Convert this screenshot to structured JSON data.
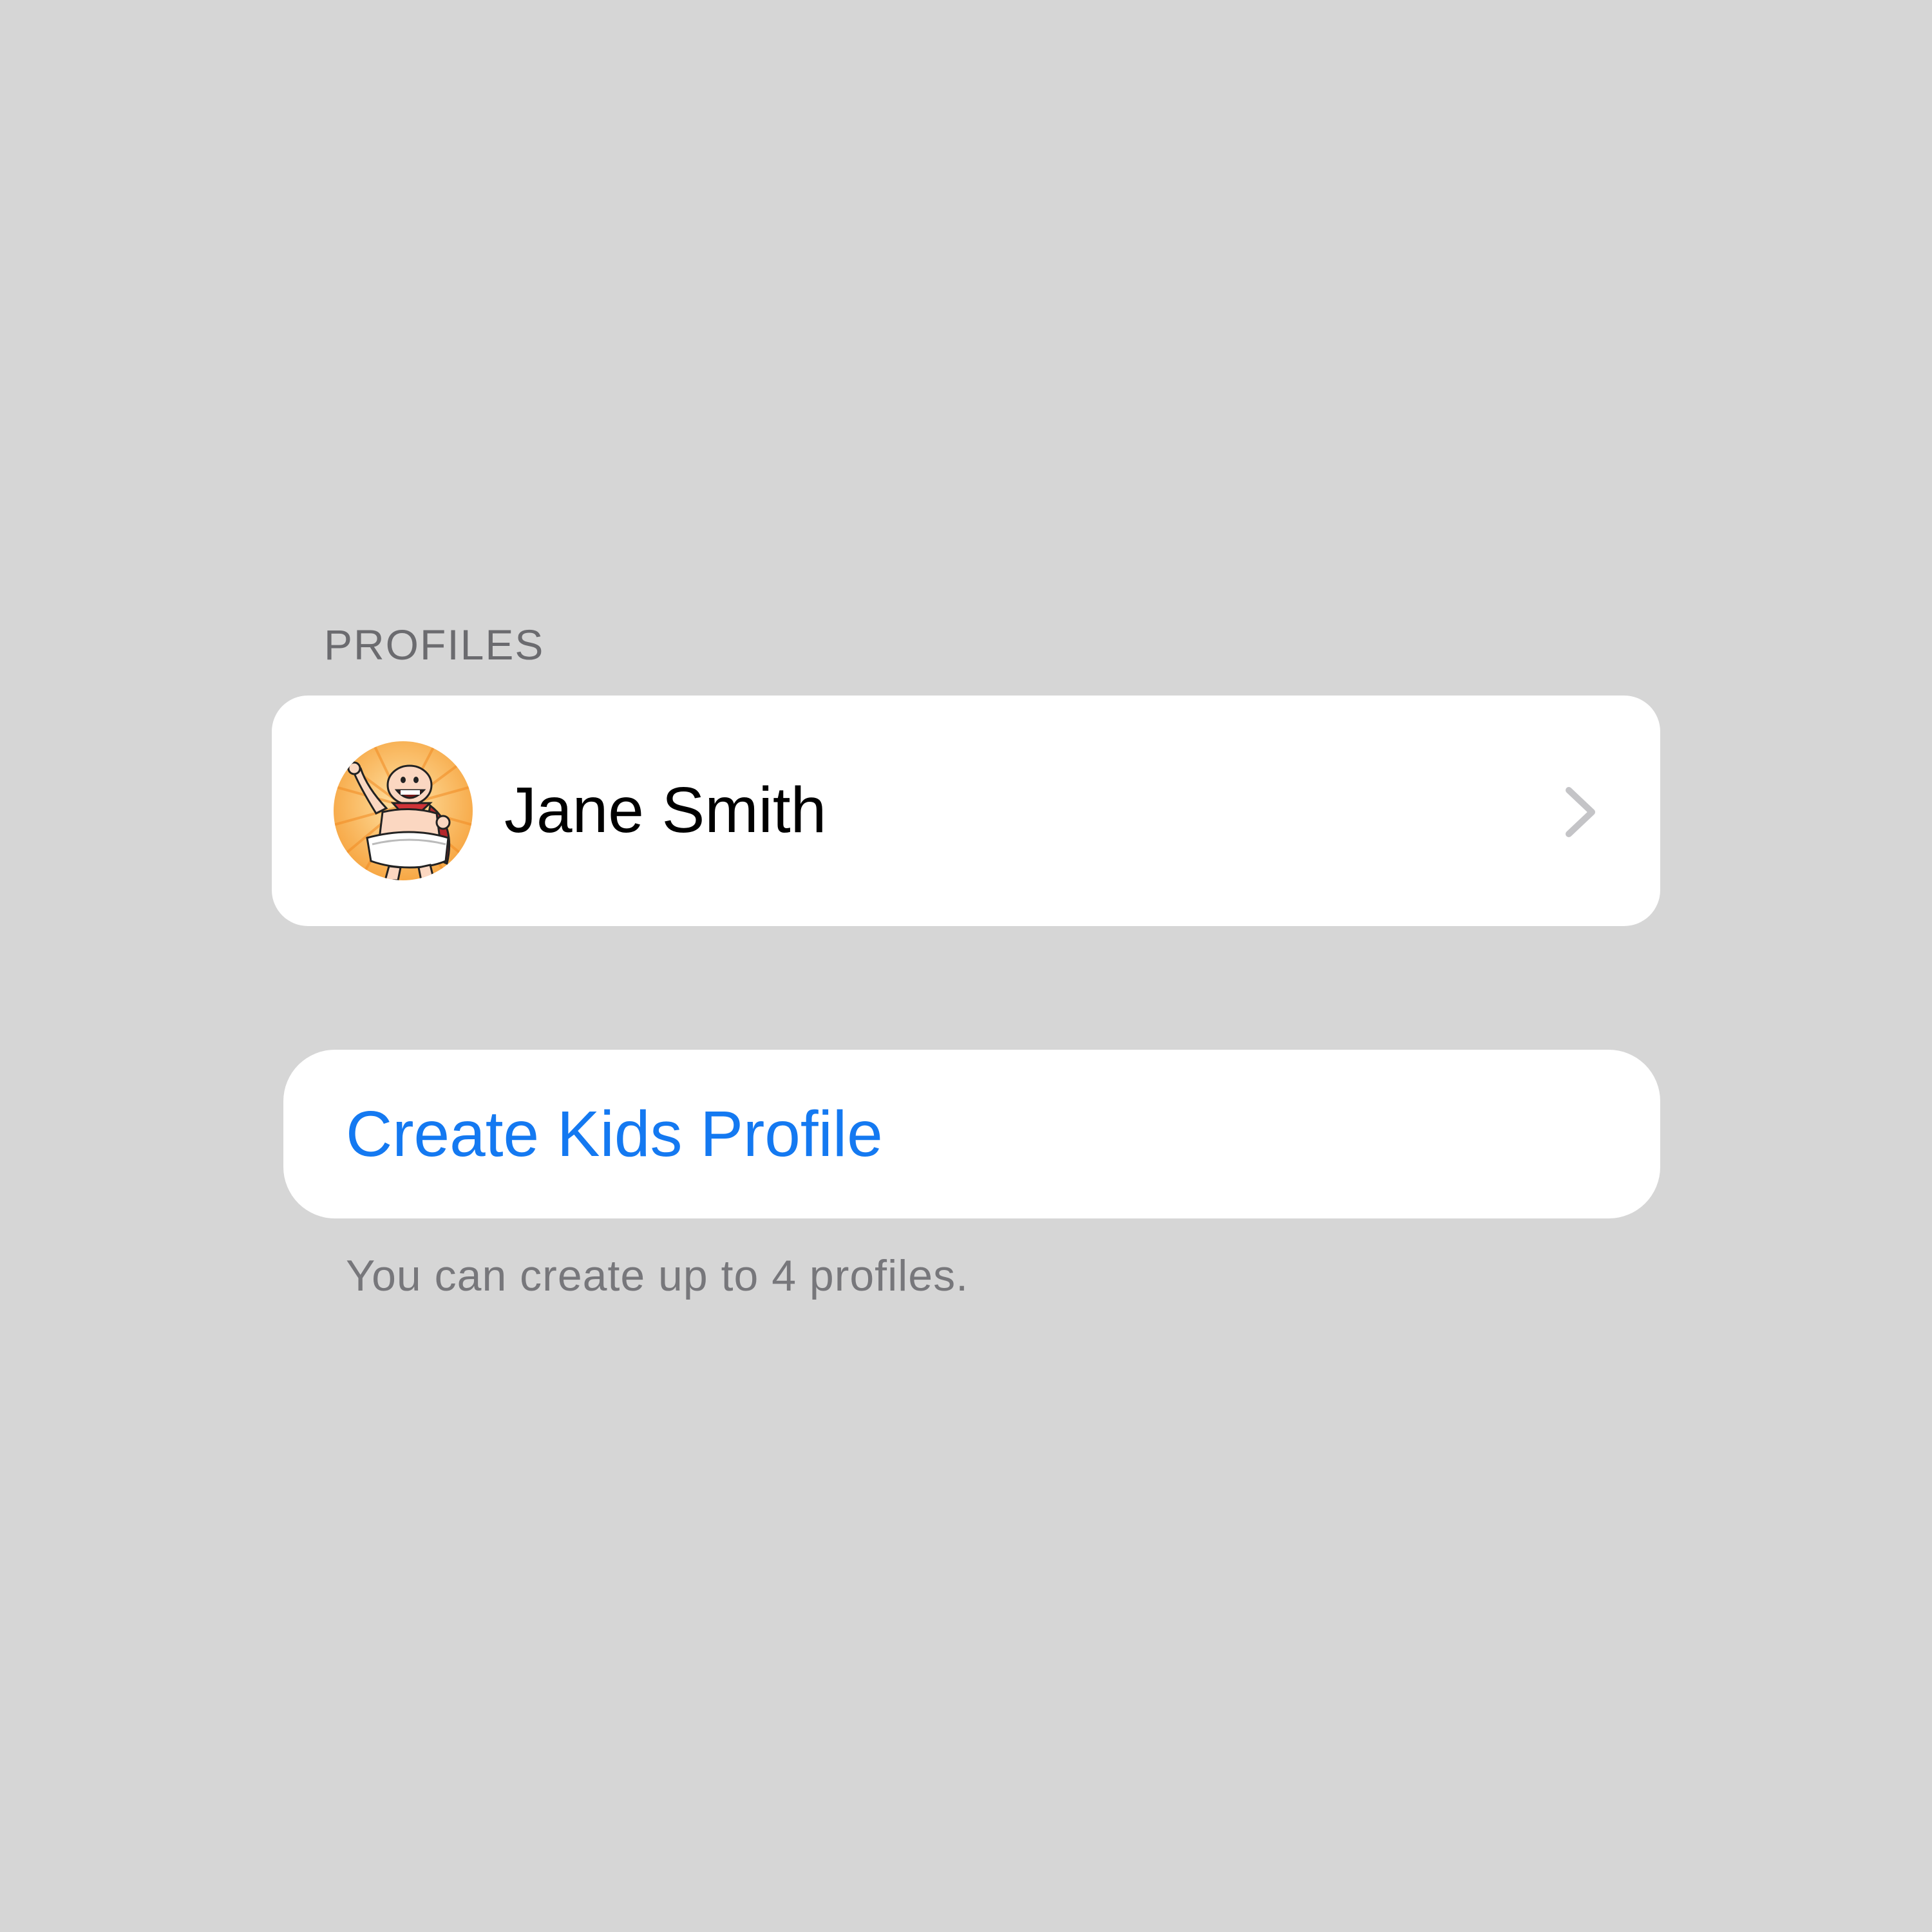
{
  "profiles_section": {
    "header": "PROFILES",
    "items": [
      {
        "name": "Jane Smith",
        "avatar_icon": "cartoon-superhero-avatar",
        "trailing_icon": "chevron-right-icon"
      }
    ]
  },
  "create_button": {
    "label": "Create Kids Profile"
  },
  "footnote": "You can create up to 4 profiles.",
  "colors": {
    "background": "#d6d6d6",
    "card": "#ffffff",
    "accent": "#1479f1",
    "secondary_text": "#6b6b6f",
    "chevron": "#c4c4c7"
  }
}
